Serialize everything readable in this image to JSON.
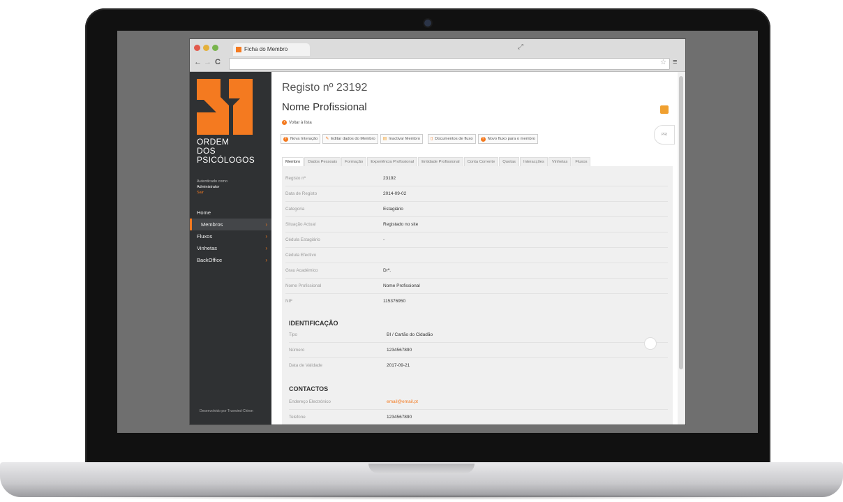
{
  "browser": {
    "tab_title": "Ficha do Membro"
  },
  "sidebar": {
    "org_line1": "ORDEM",
    "org_line2": "DOS",
    "org_line3": "PSICÓLOGOS",
    "auth_label": "Autenticado como",
    "auth_user": "Administrator",
    "logout": "Sair",
    "items": [
      {
        "label": "Home"
      },
      {
        "label": "Membros"
      },
      {
        "label": "Fluxos"
      },
      {
        "label": "Vinhetas"
      },
      {
        "label": "BackOffice"
      }
    ],
    "developed_by": "Desenvolvido por Truewind-Chiron"
  },
  "header": {
    "registo": "Registo nº 23192",
    "nome": "Nome Profissional",
    "voltar": "Voltar à lista"
  },
  "actions": [
    {
      "label": "Nova Interação"
    },
    {
      "label": "Editar dados do Membro"
    },
    {
      "label": "Inactivar Membro"
    },
    {
      "label": "Documentos de fluxo"
    },
    {
      "label": "Novo fluxo para o membro"
    }
  ],
  "tabs": [
    "Membro",
    "Dados Pessoais",
    "Formação",
    "Experiência Profissional",
    "Entidade Profissional",
    "Conta Corrente",
    "Quotas",
    "Interacções",
    "Vinhetas",
    "Fluxos"
  ],
  "side_tab": "PRI",
  "membro": [
    {
      "label": "Registo nº",
      "value": "23192"
    },
    {
      "label": "Data de Registo",
      "value": "2014-09-02"
    },
    {
      "label": "Categoria",
      "value": "Estagiário"
    },
    {
      "label": "Situação Actual",
      "value": "Registado no site"
    },
    {
      "label": "Cédula Estagiário",
      "value": "-"
    },
    {
      "label": "Cédula Efectivo",
      "value": ""
    },
    {
      "label": "Grau Académico",
      "value": "Drª."
    },
    {
      "label": "Nome Profissional",
      "value": "Nome Profissional"
    },
    {
      "label": "NIF",
      "value": "115376950"
    }
  ],
  "identificacao": {
    "title": "IDENTIFICAÇÃO",
    "rows": [
      {
        "label": "Tipo",
        "value": "BI / Cartão do Cidadão"
      },
      {
        "label": "Número",
        "value": "1234567890"
      },
      {
        "label": "Data de Validade",
        "value": "2017-09-21"
      }
    ]
  },
  "contactos": {
    "title": "CONTACTOS",
    "rows": [
      {
        "label": "Endereço Electrónico",
        "value": "email@email.pt"
      },
      {
        "label": "Telefone",
        "value": "1234567890"
      }
    ]
  },
  "colors": {
    "accent": "#f47a20",
    "sidebar": "#2f3133"
  }
}
